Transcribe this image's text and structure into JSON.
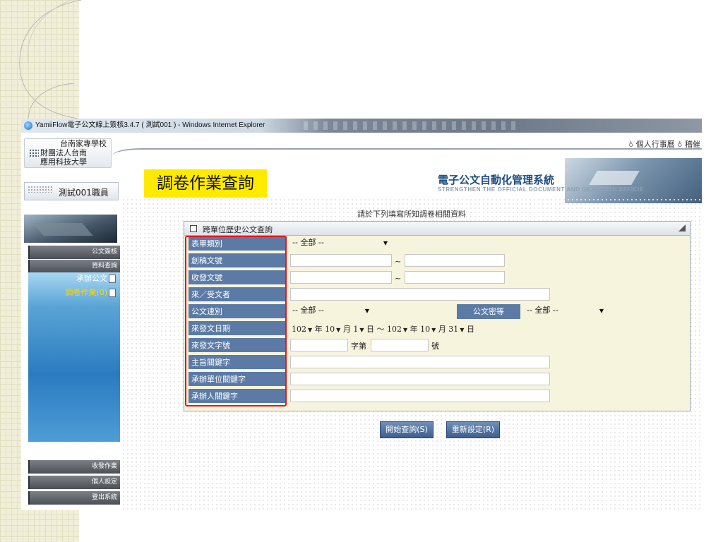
{
  "window": {
    "title": "YamiiFlow電子公文線上簽核3.4.7 ( 測試001 ) - Windows Internet Explorer"
  },
  "header": {
    "school_lines": [
      "台南家專學校",
      "財團法人台南",
      "應用科技大學"
    ],
    "links": [
      {
        "label": "個人行事曆",
        "icon": "pin-icon"
      },
      {
        "label": "稽催",
        "icon": "pin-icon"
      }
    ],
    "user": "測試001職員",
    "page_title": "調卷作業查詢",
    "logo_text": "電子公文自動化管理系統",
    "logo_sub": "STRENGTHEN THE OFFICIAL DOCUMENT AND DEAL WITH EFFICIE"
  },
  "sidebar": {
    "items_top": [
      "公文簽核",
      "資料查詢"
    ],
    "sub_items": [
      {
        "label": "承辦公文",
        "color": "#ffffff"
      },
      {
        "label": "調卷作業(0)",
        "color": "#ffd400"
      }
    ],
    "items_bottom": [
      "收發作業",
      "個人設定",
      "登出系統"
    ]
  },
  "main": {
    "instruction": "請於下列填寫所知調卷相關資料",
    "panel_title": "跨單位歷史公文查詢",
    "labels": [
      "表單類別",
      "創稿文號",
      "收發文號",
      "來／受文者",
      "公文速別",
      "來發文日期",
      "來發文字號",
      "主旨關鍵字",
      "承辦單位關鍵字",
      "承辦人關鍵字"
    ],
    "form_type": "-- 全部 --",
    "tilde": "~",
    "speed": "-- 全部 --",
    "secrecy_label": "公文密等",
    "secrecy": "-- 全部 --",
    "date": {
      "from_year": "102",
      "from_month": "10",
      "from_day": "1",
      "to_year": "102",
      "to_month": "10",
      "to_day": "31",
      "year_unit": "年",
      "month_unit": "月",
      "day_unit": "日",
      "range_sep": "～"
    },
    "doc_no": {
      "middle": "字第",
      "suffix": "號"
    }
  },
  "buttons": {
    "search": "開始查詢(S)",
    "reset": "重新設定(R)"
  },
  "colors": {
    "label_bg": "#5b7ba6",
    "form_bg": "#f7f4de",
    "highlight": "#e3161b",
    "title_bg": "#ffea00"
  }
}
